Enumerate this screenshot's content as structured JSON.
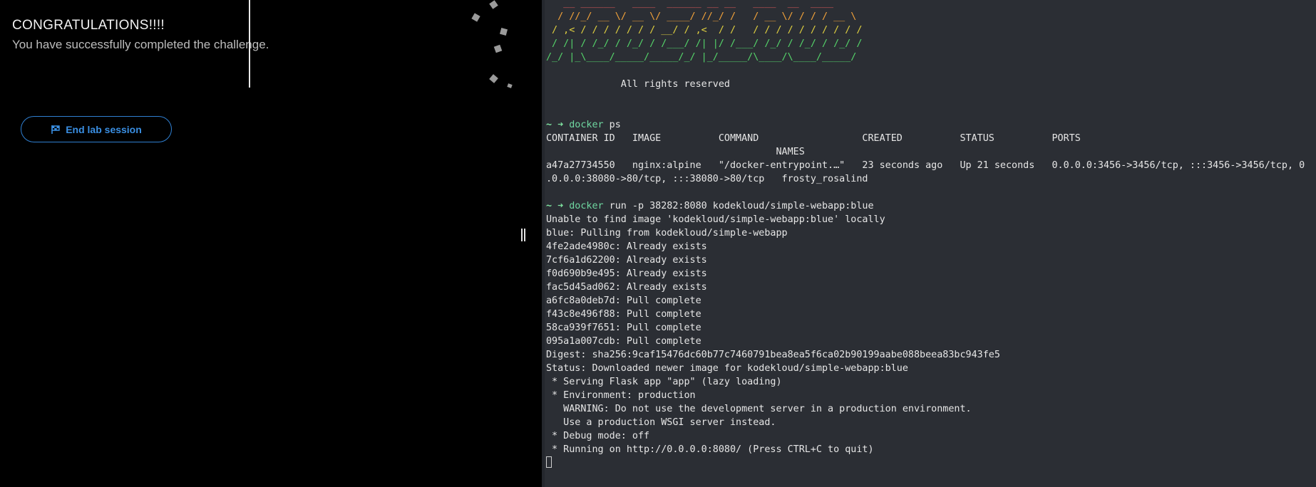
{
  "left_panel": {
    "title": "CONGRATULATIONS!!!!",
    "subtitle": "You have successfully completed the challenge.",
    "end_button_label": "End lab session"
  },
  "terminal": {
    "banner": [
      "   __ ______   ____  ______ __ __   ____  __  ____",
      "  / //_/ __ \\/ __ \\/ ____/ //_/ /   / __ \\/ / / / __ \\",
      " / ,< / / / / / / / __/ / ,<  / /   / / / / / / / / / /",
      " / /| / /_/ / /_/ / /___/ /| |/ /___/ /_/ / /_/ / /_/ /",
      "/_/ |_\\____/_____/_____/_/ |_/_____/\\____/\\____/_____/"
    ],
    "rights": "             All rights reserved",
    "prompt1_cmd": "docker",
    "prompt1_args": " ps",
    "ps_header1": "CONTAINER ID   IMAGE          COMMAND                  CREATED          STATUS          PORTS",
    "ps_header2": "                                        NAMES",
    "ps_row1": "a47a27734550   nginx:alpine   \"/docker-entrypoint.…\"   23 seconds ago   Up 21 seconds   0.0.0.0:3456->3456/tcp, :::3456->3456/tcp, 0",
    "ps_row2": ".0.0.0:38080->80/tcp, :::38080->80/tcp   frosty_rosalind",
    "prompt2_cmd": "docker",
    "prompt2_args": " run -p 38282:8080 kodekloud/simple-webapp:blue",
    "output": [
      "Unable to find image 'kodekloud/simple-webapp:blue' locally",
      "blue: Pulling from kodekloud/simple-webapp",
      "4fe2ade4980c: Already exists",
      "7cf6a1d62200: Already exists",
      "f0d690b9e495: Already exists",
      "fac5d45ad062: Already exists",
      "a6fc8a0deb7d: Pull complete",
      "f43c8e496f88: Pull complete",
      "58ca939f7651: Pull complete",
      "095a1a007cdb: Pull complete",
      "Digest: sha256:9caf15476dc60b77c7460791bea8ea5f6ca02b90199aabe088beea83bc943fe5",
      "Status: Downloaded newer image for kodekloud/simple-webapp:blue",
      " * Serving Flask app \"app\" (lazy loading)",
      " * Environment: production",
      "   WARNING: Do not use the development server in a production environment.",
      "   Use a production WSGI server instead.",
      " * Debug mode: off",
      " * Running on http://0.0.0.0:8080/ (Press CTRL+C to quit)"
    ]
  },
  "colors": {
    "button_accent": "#3a8fe3",
    "terminal_bg": "#2b2e34",
    "prompt_green": "#7fe3a0"
  }
}
